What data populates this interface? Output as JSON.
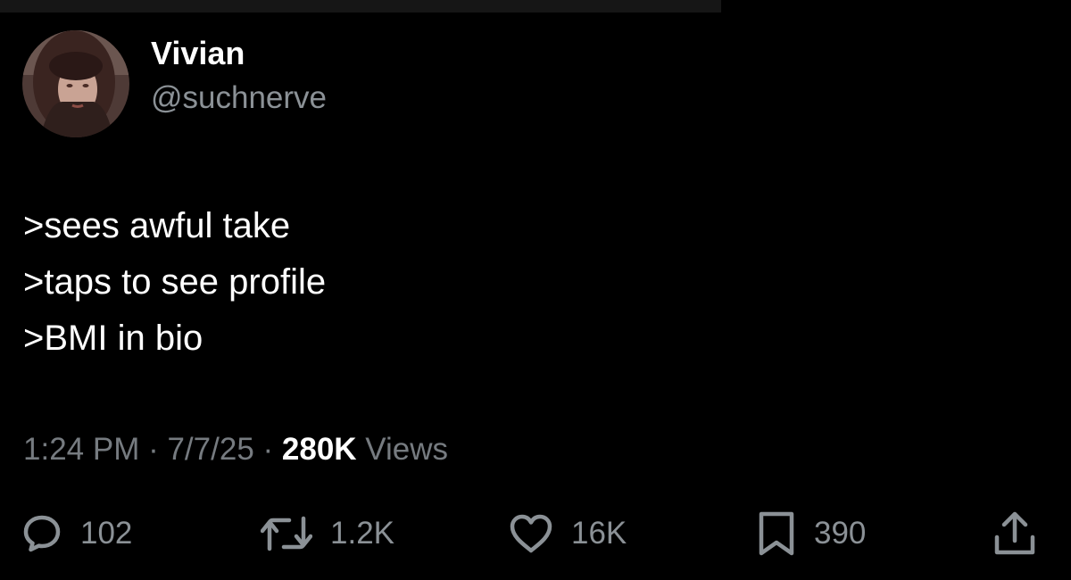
{
  "tweet": {
    "author": {
      "display_name": "Vivian",
      "handle": "@suchnerve"
    },
    "lines": [
      ">sees awful take",
      ">taps to see profile",
      ">BMI in bio"
    ],
    "timestamp": {
      "time": "1:24 PM",
      "separator": " · ",
      "date": "7/7/25",
      "views_count": "280K",
      "views_label": " Views"
    },
    "actions": {
      "replies": "102",
      "reposts": "1.2K",
      "likes": "16K",
      "bookmarks": "390"
    }
  },
  "icons": {
    "reply": "speech-bubble-icon",
    "repost": "repost-arrows-icon",
    "like": "heart-icon",
    "bookmark": "bookmark-icon",
    "share": "share-upload-icon"
  },
  "colors": {
    "background": "#000000",
    "text_primary": "#ffffff",
    "text_secondary": "#8b9196"
  }
}
